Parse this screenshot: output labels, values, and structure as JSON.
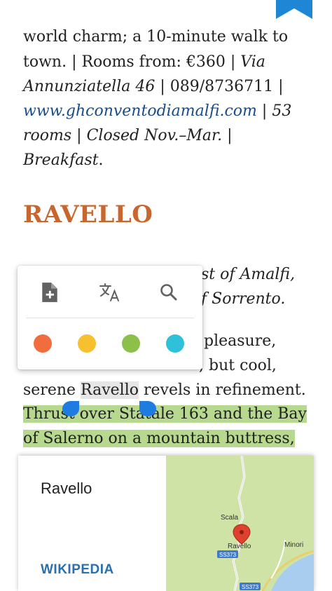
{
  "reader": {
    "lines": [
      {
        "text": "world charm; a 10-minute walk to"
      },
      {
        "a": "town. | Rooms from: €360 | ",
        "b": "Via"
      },
      {
        "a": "Annunziatella 46",
        "b": " | 089/8736711 |"
      },
      {
        "a": "www.ghconventodiamalfi.com",
        "b": " | 53"
      },
      {
        "a": "rooms",
        "b": " | ",
        "c": "Closed Nov.–Mar.",
        "d": " |"
      },
      {
        "a": "Breakfast",
        "b": "."
      }
    ],
    "heading": "RAVELLO",
    "partial_lines": [
      {
        "text": "st of Amalfi,"
      },
      {
        "text": "f Sorrento."
      },
      {
        "text": "pleasure,"
      },
      {
        "text": ", but cool,"
      }
    ],
    "sentence": {
      "before": "serene ",
      "selected": "Ravello",
      "after": " revels in refinement."
    },
    "highlight_lines": [
      {
        "text": "Thrust over Statale 163 and the Bay"
      },
      {
        "text": "of Salerno on a mountain buttress,"
      }
    ]
  },
  "popup": {
    "tools": [
      {
        "name": "add-note-icon"
      },
      {
        "name": "translate-icon"
      },
      {
        "name": "search-icon"
      }
    ],
    "colors": [
      "#f26d3d",
      "#f7c02f",
      "#8cc04b",
      "#2ec1d9"
    ]
  },
  "card": {
    "title": "Ravello",
    "link": "WIKIPEDIA",
    "map": {
      "labels": {
        "scala": "Scala",
        "ravello": "Ravello",
        "minori": "Minori"
      },
      "roads": {
        "ss373_a": "SS373",
        "ss373_b": "SS373"
      }
    }
  }
}
